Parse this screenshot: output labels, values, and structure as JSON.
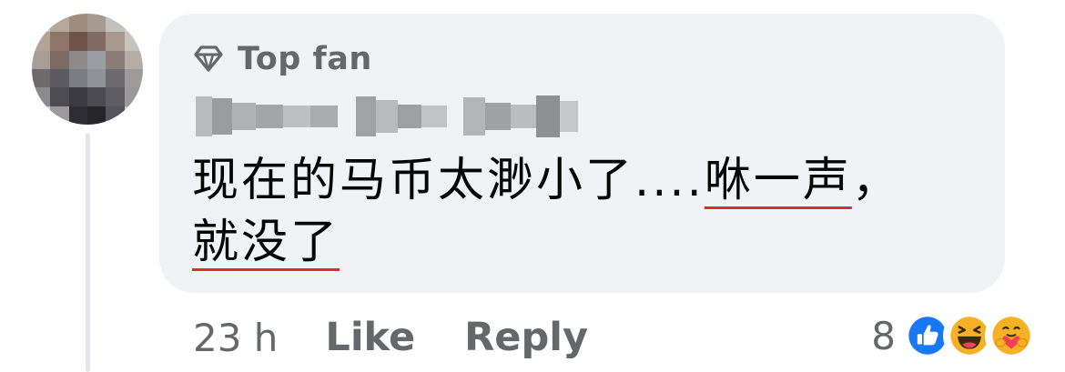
{
  "comment": {
    "badge_label": "Top fan",
    "badge_icon": "diamond-icon",
    "text_plain": "现在的马币太渺小了....",
    "text_underlined_1": "咻一声",
    "text_punct": "，",
    "text_underlined_2": "就没了"
  },
  "actions": {
    "time": "23 h",
    "like_label": "Like",
    "reply_label": "Reply"
  },
  "reactions": {
    "count": "8",
    "icons": [
      "like-icon",
      "haha-icon",
      "care-icon"
    ],
    "colors": {
      "like": "#1877f2",
      "haha": "#f7b125",
      "care": "#f7b125"
    }
  },
  "colors": {
    "bubble_bg": "#f0f2f5",
    "secondary_text": "#65676b",
    "primary_text": "#050505",
    "spellcheck_underline": "#e02b2b"
  }
}
